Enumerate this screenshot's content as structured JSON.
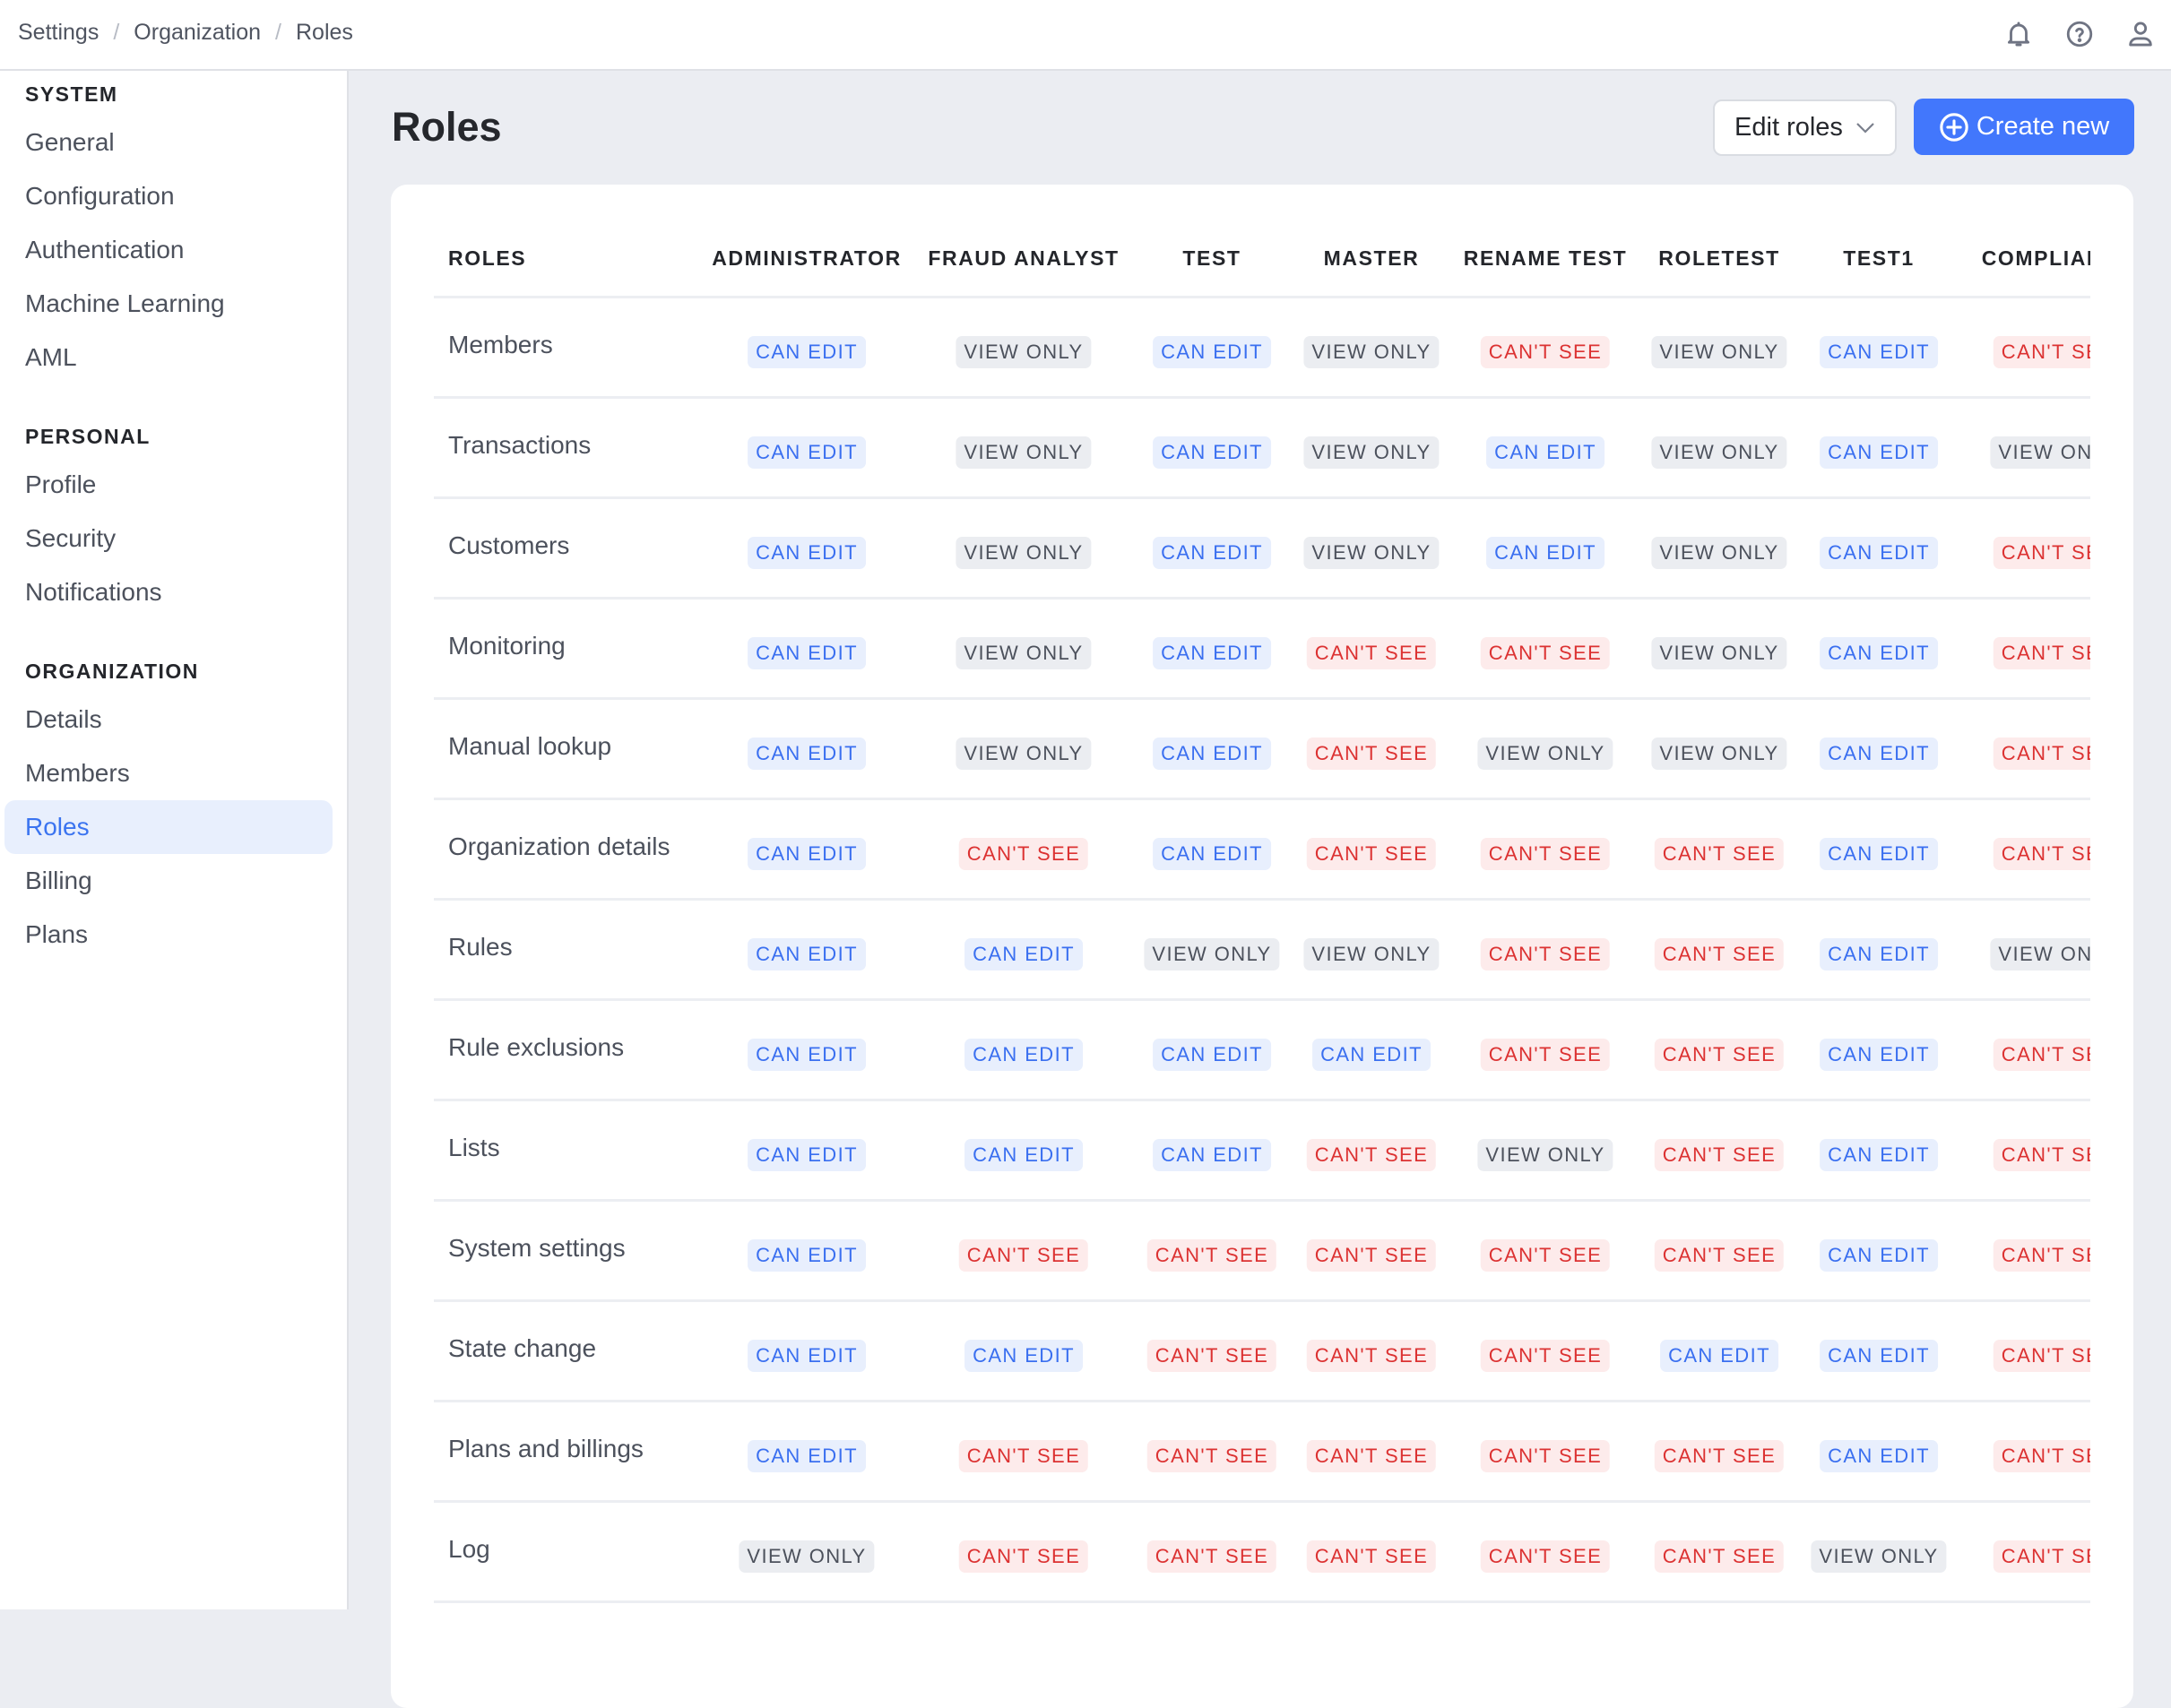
{
  "breadcrumb": [
    "Settings",
    "Organization",
    "Roles"
  ],
  "top_icons": [
    "bell-icon",
    "help-icon",
    "user-icon"
  ],
  "sidebar": {
    "sections": [
      {
        "title": "SYSTEM",
        "items": [
          {
            "label": "General",
            "active": false
          },
          {
            "label": "Configuration",
            "active": false
          },
          {
            "label": "Authentication",
            "active": false
          },
          {
            "label": "Machine Learning",
            "active": false
          },
          {
            "label": "AML",
            "active": false
          }
        ]
      },
      {
        "title": "PERSONAL",
        "items": [
          {
            "label": "Profile",
            "active": false
          },
          {
            "label": "Security",
            "active": false
          },
          {
            "label": "Notifications",
            "active": false
          }
        ]
      },
      {
        "title": "ORGANIZATION",
        "items": [
          {
            "label": "Details",
            "active": false
          },
          {
            "label": "Members",
            "active": false
          },
          {
            "label": "Roles",
            "active": true
          },
          {
            "label": "Billing",
            "active": false
          },
          {
            "label": "Plans",
            "active": false
          }
        ]
      }
    ]
  },
  "page": {
    "title": "Roles",
    "edit_roles_label": "Edit roles",
    "create_new_label": "Create new"
  },
  "permission_labels": {
    "edit": "CAN EDIT",
    "view": "VIEW ONLY",
    "none": "CAN'T SEE"
  },
  "colors": {
    "accent": "#4277fc",
    "can_edit_text": "#3a6ff0",
    "can_edit_bg": "#e8effd",
    "view_only_text": "#4c515c",
    "view_only_bg": "#ebedf1",
    "cant_see_text": "#dc3232",
    "cant_see_bg": "#fdebeb"
  },
  "table": {
    "header_label": "ROLES",
    "columns": [
      "ADMINISTRATOR",
      "FRAUD ANALYST",
      "TEST",
      "MASTER",
      "RENAME TEST",
      "ROLETEST",
      "TEST1",
      "COMPLIANCE"
    ],
    "rows": [
      {
        "label": "Members",
        "values": [
          "edit",
          "view",
          "edit",
          "view",
          "none",
          "view",
          "edit",
          "none"
        ]
      },
      {
        "label": "Transactions",
        "values": [
          "edit",
          "view",
          "edit",
          "view",
          "edit",
          "view",
          "edit",
          "view"
        ]
      },
      {
        "label": "Customers",
        "values": [
          "edit",
          "view",
          "edit",
          "view",
          "edit",
          "view",
          "edit",
          "none"
        ]
      },
      {
        "label": "Monitoring",
        "values": [
          "edit",
          "view",
          "edit",
          "none",
          "none",
          "view",
          "edit",
          "none"
        ]
      },
      {
        "label": "Manual lookup",
        "values": [
          "edit",
          "view",
          "edit",
          "none",
          "view",
          "view",
          "edit",
          "none"
        ]
      },
      {
        "label": "Organization details",
        "values": [
          "edit",
          "none",
          "edit",
          "none",
          "none",
          "none",
          "edit",
          "none"
        ]
      },
      {
        "label": "Rules",
        "values": [
          "edit",
          "edit",
          "view",
          "view",
          "none",
          "none",
          "edit",
          "view"
        ]
      },
      {
        "label": "Rule exclusions",
        "values": [
          "edit",
          "edit",
          "edit",
          "edit",
          "none",
          "none",
          "edit",
          "none"
        ]
      },
      {
        "label": "Lists",
        "values": [
          "edit",
          "edit",
          "edit",
          "none",
          "view",
          "none",
          "edit",
          "none"
        ]
      },
      {
        "label": "System settings",
        "values": [
          "edit",
          "none",
          "none",
          "none",
          "none",
          "none",
          "edit",
          "none"
        ]
      },
      {
        "label": "State change",
        "values": [
          "edit",
          "edit",
          "none",
          "none",
          "none",
          "edit",
          "edit",
          "none"
        ]
      },
      {
        "label": "Plans and billings",
        "values": [
          "edit",
          "none",
          "none",
          "none",
          "none",
          "none",
          "edit",
          "none"
        ]
      },
      {
        "label": "Log",
        "values": [
          "view",
          "none",
          "none",
          "none",
          "none",
          "none",
          "view",
          "none"
        ]
      }
    ]
  }
}
